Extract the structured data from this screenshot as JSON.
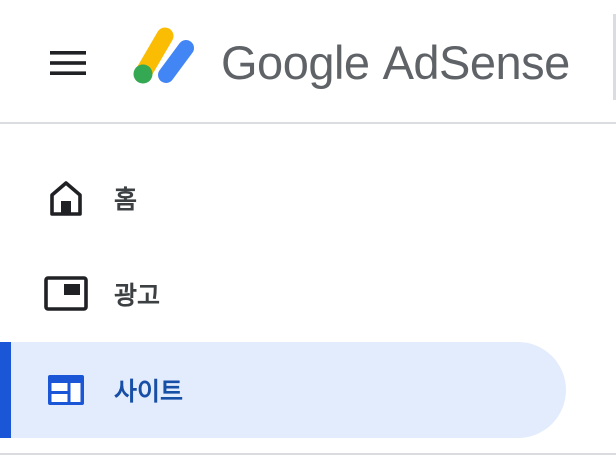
{
  "header": {
    "brand_primary": "Google",
    "brand_secondary": "AdSense",
    "brand_color": "#5f6368",
    "menu_icon": "hamburger-menu-icon",
    "logo_icon": "adsense-logo-icon",
    "logo_colors": {
      "yellow": "#fbbc04",
      "green": "#34a853",
      "blue": "#4285f4"
    }
  },
  "nav": {
    "items": [
      {
        "label": "홈",
        "icon": "home-icon",
        "selected": false
      },
      {
        "label": "광고",
        "icon": "ads-icon",
        "selected": false
      },
      {
        "label": "사이트",
        "icon": "sites-icon",
        "selected": true
      }
    ],
    "selected_bg": "#e3ecfd",
    "selected_accent": "#1a56d6",
    "selected_text": "#174ea6",
    "text_color": "#3c4043"
  }
}
